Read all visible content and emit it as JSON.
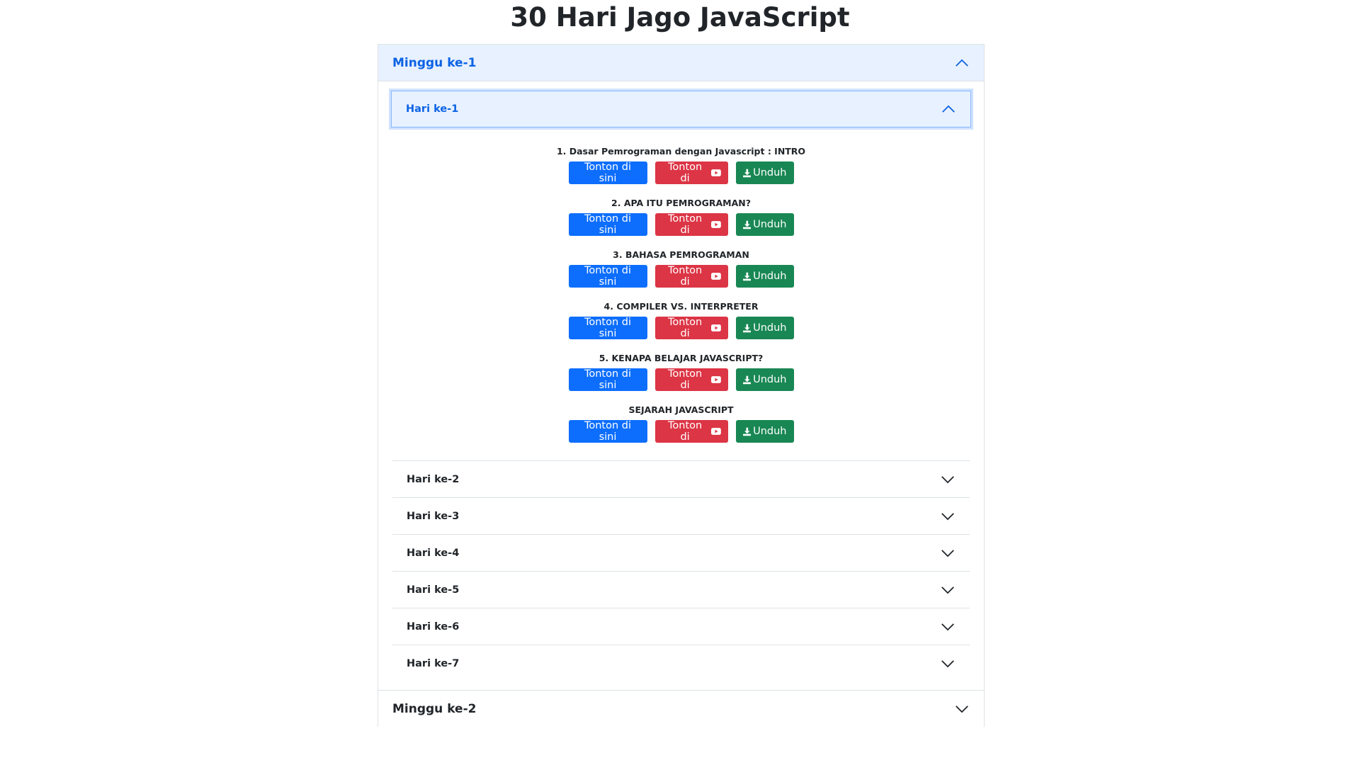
{
  "page": {
    "title": "30 Hari Jago JavaScript"
  },
  "colors": {
    "open_header_bg": "#e7f1ff",
    "open_header_text": "#0c63e4",
    "button_blue": "#0d6efd",
    "button_red": "#dc3545",
    "button_green": "#198754",
    "border": "#dee2e6"
  },
  "weeks": [
    {
      "label": "Minggu ke-1",
      "expanded": true,
      "icon": "chevron-up-icon",
      "days": [
        {
          "label": "Hari ke-1",
          "expanded": true,
          "icon": "chevron-up-icon",
          "lessons": [
            {
              "title": "1. Dasar Pemrograman dengan Javascript : INTRO"
            },
            {
              "title": "2. APA ITU PEMROGRAMAN?"
            },
            {
              "title": "3. BAHASA PEMROGRAMAN"
            },
            {
              "title": "4. COMPILER VS. INTERPRETER"
            },
            {
              "title": "5. KENAPA BELAJAR JAVASCRIPT?"
            },
            {
              "title": "SEJARAH JAVASCRIPT"
            }
          ]
        },
        {
          "label": "Hari ke-2",
          "expanded": false,
          "icon": "chevron-down-icon"
        },
        {
          "label": "Hari ke-3",
          "expanded": false,
          "icon": "chevron-down-icon"
        },
        {
          "label": "Hari ke-4",
          "expanded": false,
          "icon": "chevron-down-icon"
        },
        {
          "label": "Hari ke-5",
          "expanded": false,
          "icon": "chevron-down-icon"
        },
        {
          "label": "Hari ke-6",
          "expanded": false,
          "icon": "chevron-down-icon"
        },
        {
          "label": "Hari ke-7",
          "expanded": false,
          "icon": "chevron-down-icon"
        }
      ]
    },
    {
      "label": "Minggu ke-2",
      "expanded": false,
      "icon": "chevron-down-icon"
    }
  ],
  "buttons": {
    "watch_here": "Tonton di sini",
    "watch_on": "Tonton di",
    "watch_on_icon": "youtube-icon",
    "download": "Unduh",
    "download_icon": "download-icon"
  }
}
